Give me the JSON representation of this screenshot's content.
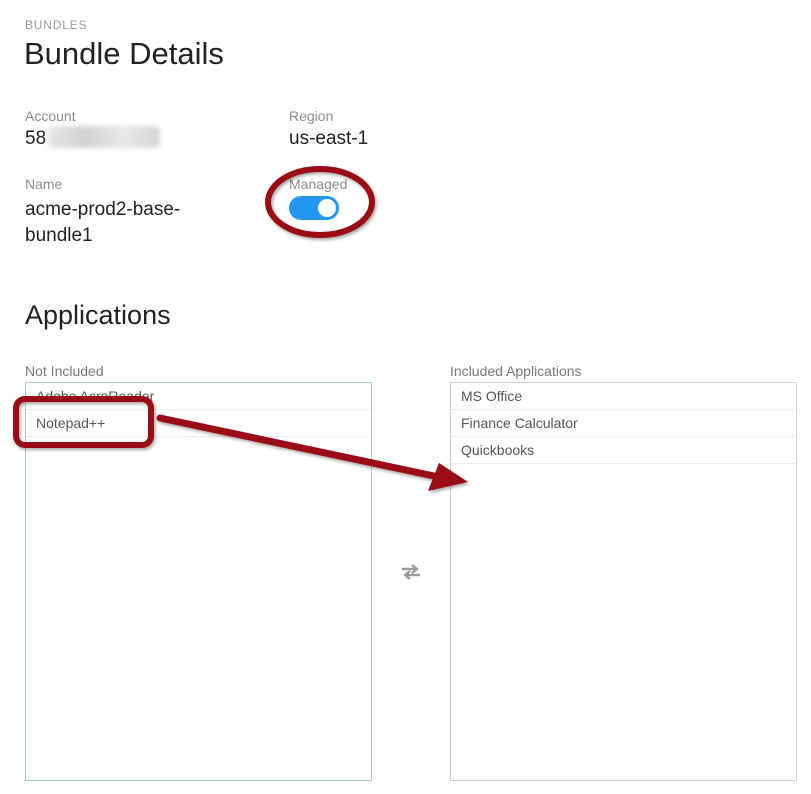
{
  "header": {
    "eyebrow": "BUNDLES",
    "title": "Bundle Details"
  },
  "details": {
    "account_label": "Account",
    "account_value": "58",
    "region_label": "Region",
    "region_value": "us-east-1",
    "name_label": "Name",
    "name_line1": "acme-prod2-base-",
    "name_line2": "bundle1",
    "managed_label": "Managed",
    "managed_on": true
  },
  "applications": {
    "title": "Applications",
    "not_included_label": "Not Included",
    "not_included": [
      {
        "label": "Adobe AcroReader"
      },
      {
        "label": "Notepad++"
      }
    ],
    "included_label": "Included Applications",
    "included": [
      {
        "label": "MS Office"
      },
      {
        "label": "Finance Calculator"
      },
      {
        "label": "Quickbooks"
      }
    ]
  },
  "icons": {
    "transfer": "swap-arrows-icon",
    "toggle": "toggle-switch"
  },
  "colors": {
    "toggle_on": "#2196f3",
    "annotation": "#9b0f14",
    "list_focus_border": "#9fc8ea"
  }
}
